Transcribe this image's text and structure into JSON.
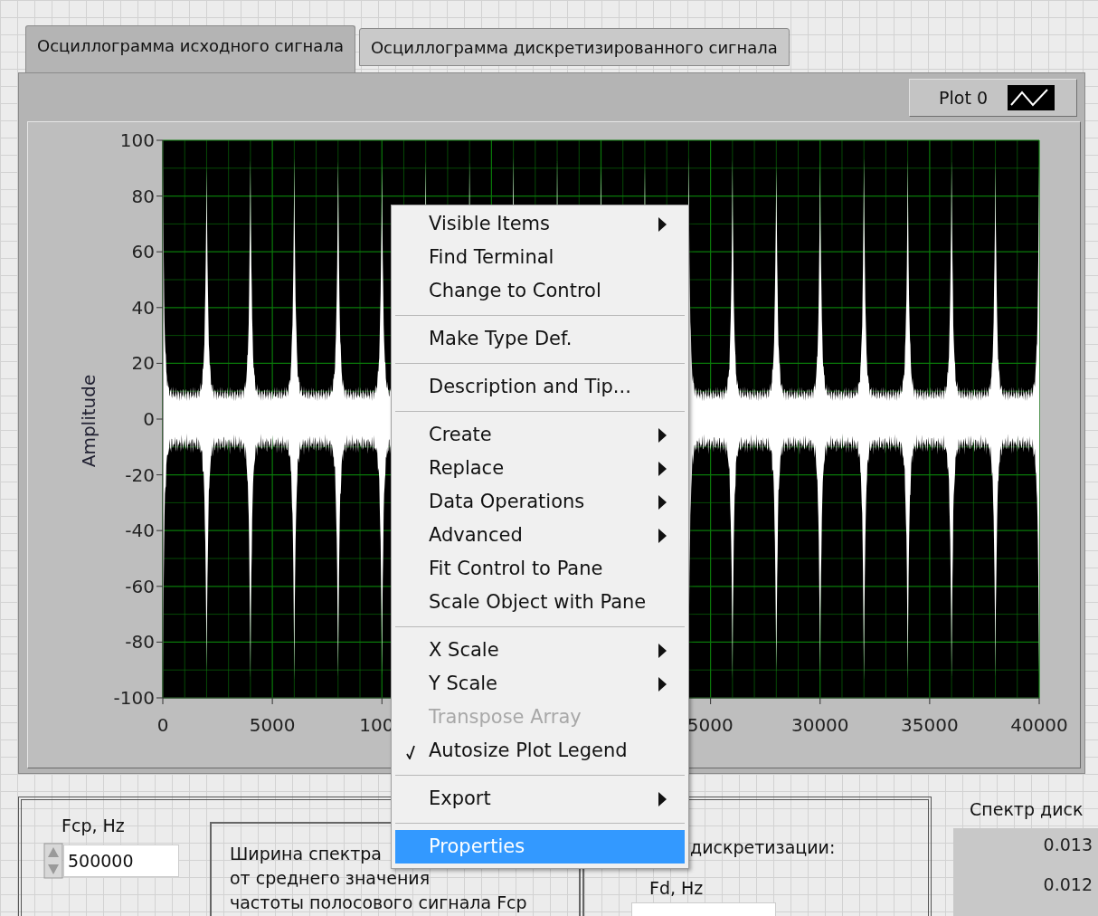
{
  "tabs": [
    {
      "label": "Осциллограмма исходного сигнала",
      "selected": true
    },
    {
      "label": "Осциллограмма дискретизированного сигнала",
      "selected": false
    }
  ],
  "legend": {
    "label": "Plot 0"
  },
  "graph": {
    "ylabel": "Amplitude",
    "yticks": [
      "100",
      "80",
      "60",
      "40",
      "20",
      "0",
      "-20",
      "-40",
      "-60",
      "-80",
      "-100"
    ],
    "xticks": [
      "0",
      "5000",
      "100",
      "5000",
      "30000",
      "35000",
      "40000"
    ]
  },
  "context_menu": [
    {
      "kind": "item",
      "label": "Visible Items",
      "submenu": true,
      "disabled": false,
      "checked": false,
      "selected": false
    },
    {
      "kind": "item",
      "label": "Find Terminal",
      "submenu": false,
      "disabled": false,
      "checked": false,
      "selected": false
    },
    {
      "kind": "item",
      "label": "Change to Control",
      "submenu": false,
      "disabled": false,
      "checked": false,
      "selected": false
    },
    {
      "kind": "separator"
    },
    {
      "kind": "item",
      "label": "Make Type Def.",
      "submenu": false,
      "disabled": false,
      "checked": false,
      "selected": false
    },
    {
      "kind": "separator"
    },
    {
      "kind": "item",
      "label": "Description and Tip...",
      "submenu": false,
      "disabled": false,
      "checked": false,
      "selected": false
    },
    {
      "kind": "separator"
    },
    {
      "kind": "item",
      "label": "Create",
      "submenu": true,
      "disabled": false,
      "checked": false,
      "selected": false
    },
    {
      "kind": "item",
      "label": "Replace",
      "submenu": true,
      "disabled": false,
      "checked": false,
      "selected": false
    },
    {
      "kind": "item",
      "label": "Data Operations",
      "submenu": true,
      "disabled": false,
      "checked": false,
      "selected": false
    },
    {
      "kind": "item",
      "label": "Advanced",
      "submenu": true,
      "disabled": false,
      "checked": false,
      "selected": false
    },
    {
      "kind": "item",
      "label": "Fit Control to Pane",
      "submenu": false,
      "disabled": false,
      "checked": false,
      "selected": false
    },
    {
      "kind": "item",
      "label": "Scale Object with Pane",
      "submenu": false,
      "disabled": false,
      "checked": false,
      "selected": false
    },
    {
      "kind": "separator"
    },
    {
      "kind": "item",
      "label": "X Scale",
      "submenu": true,
      "disabled": false,
      "checked": false,
      "selected": false
    },
    {
      "kind": "item",
      "label": "Y Scale",
      "submenu": true,
      "disabled": false,
      "checked": false,
      "selected": false
    },
    {
      "kind": "item",
      "label": "Transpose Array",
      "submenu": false,
      "disabled": true,
      "checked": false,
      "selected": false
    },
    {
      "kind": "item",
      "label": "Autosize Plot Legend",
      "submenu": false,
      "disabled": false,
      "checked": true,
      "selected": false
    },
    {
      "kind": "separator"
    },
    {
      "kind": "item",
      "label": "Export",
      "submenu": true,
      "disabled": false,
      "checked": false,
      "selected": false
    },
    {
      "kind": "separator"
    },
    {
      "kind": "item",
      "label": "Properties",
      "submenu": false,
      "disabled": false,
      "checked": false,
      "selected": true
    }
  ],
  "fcp": {
    "label": "Fcp, Hz",
    "value": "500000"
  },
  "bandwidth_note": {
    "lines": [
      "Ширина спектра",
      "от среднего значения",
      "частоты полосового сигнала Fcp"
    ]
  },
  "sampling": {
    "caption": "дискретизации:",
    "label": "Fd, Hz"
  },
  "spectrum": {
    "title": "Спектр диск",
    "ticks": [
      "0.013",
      "0.012"
    ]
  }
}
